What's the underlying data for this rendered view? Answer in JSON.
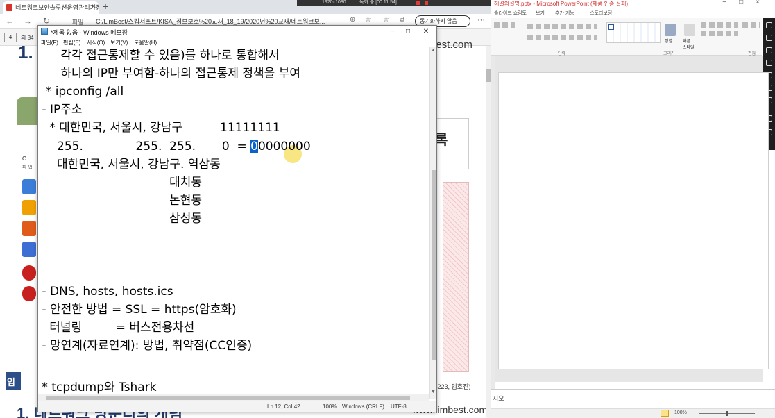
{
  "browser": {
    "tab_title": "네트워크보안솔루션운영관리가정",
    "address": "C:/LimBest/스킴서포트/KISA_정보보호%20교재_18_19/2020년%20교재/네트워크보...",
    "file_label": "파일",
    "sync_label": "동기화하지 않음",
    "recording_res": "1920x1080",
    "recording_time": "녹화 중 [00:11:54]",
    "page_num": "4",
    "page_of": "의 84",
    "heading_number": "1.",
    "site_top": "best.com",
    "right_card_text": "록",
    "side_letter": "임",
    "author_text": "s223, 임호진)",
    "bottom_title": "1. 네트워크 망분리의 개념",
    "site_bottom": "www.limbest.com",
    "dropdown_label": "O",
    "dropdown_sub": "파 업"
  },
  "ppt": {
    "title": "해결의설명.pptx - Microsoft PowerPoint (제품 인증 실패)",
    "ribbon_tabs": [
      "슬라이드 쇼",
      "검토",
      "보기",
      "추가 기능",
      "스토리보딩"
    ],
    "group_paragraph": "단락",
    "group_drawing": "그리기",
    "group_editing": "편집",
    "arrange_label": "정렬",
    "quickstyle_label": "빠른\n스타일",
    "notes_text": "시오",
    "zoom": "100%"
  },
  "notepad": {
    "title": "*제목 없음 - Windows 메모장",
    "menus": [
      "파일(F)",
      "편집(E)",
      "서식(O)",
      "보기(V)",
      "도움말(H)"
    ],
    "lines": [
      "      각각 접근통제할 수 있음)를 하나로 통합해서",
      "      하나의 IP만 부여함-하나의 접근통제 정책을 부여",
      "  * ipconfig /all",
      " - IP주소",
      "   * 대한민국, 서울시, 강남구          11111111",
      "     255.              255.  255.       0  = ",
      "     대한민국, 서울시, 강남구. 역삼동",
      "                                   대치동",
      "                                   논현동",
      "                                   삼성동",
      "",
      "",
      "",
      " - DNS, hosts, hosts.ics",
      " - 안전한 방법 = SSL = https(암호화)",
      "   터널링         = 버스전용차선",
      " - 망연계(자료연계): 방법, 취약점(CC인증)",
      "",
      "",
      "",
      " * tcpdump와 Tshark"
    ],
    "selected_char": "0",
    "after_selection": "0000000",
    "status": {
      "position": "Ln 12, Col 42",
      "zoom": "100%",
      "eol": "Windows (CRLF)",
      "encoding": "UTF-8"
    }
  }
}
